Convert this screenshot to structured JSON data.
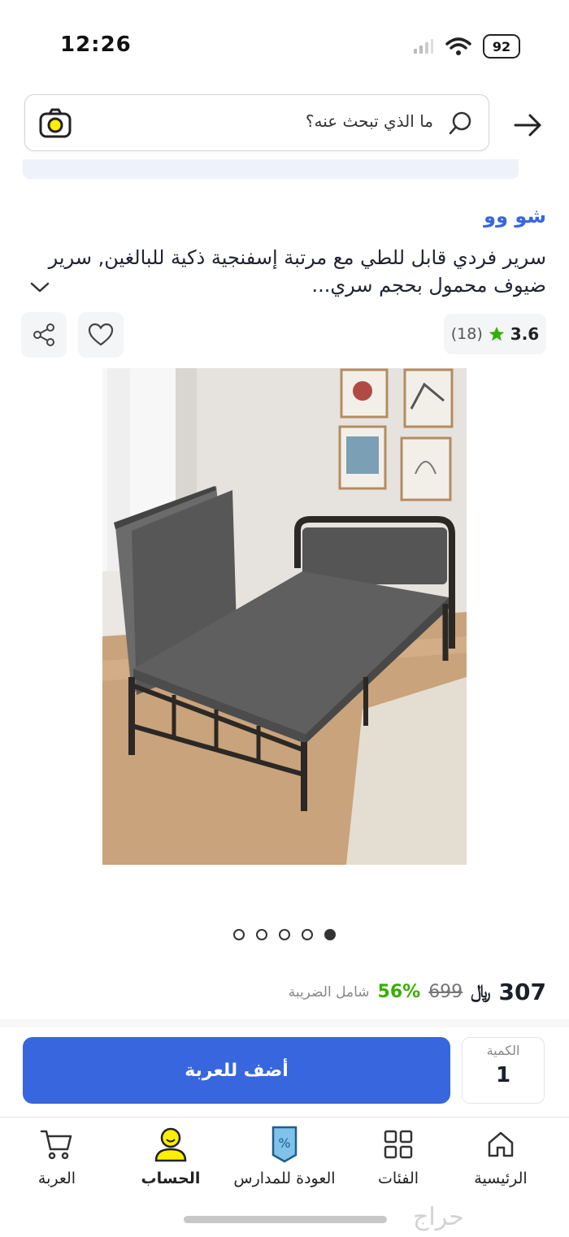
{
  "status_bar": {
    "time": "12:26",
    "battery": "92"
  },
  "search": {
    "placeholder": "ما الذي تبحث عنه؟"
  },
  "product": {
    "brand": "شو وو",
    "title": "سرير فردي قابل للطي مع مرتبة إسفنجية ذكية للبالغين, سرير ضيوف محمول بحجم سري...",
    "rating": "3.6",
    "review_count": "(18)",
    "image_count": 5,
    "active_image": 5
  },
  "price": {
    "current": "307",
    "currency": "﷼",
    "old": "699",
    "discount": "56%",
    "tax_note": "شامل الضريبة"
  },
  "cart": {
    "add_label": "أضف للعربة",
    "qty_label": "الكمية",
    "qty_value": "1"
  },
  "nav": {
    "home": "الرئيسية",
    "categories": "الفئات",
    "back_to_school": "العودة للمدارس",
    "account": "الحساب",
    "cart": "العربة"
  },
  "watermark": "حراج",
  "colors": {
    "brand_blue": "#3866df",
    "discount_green": "#38ae04",
    "noon_yellow": "#feee00"
  }
}
